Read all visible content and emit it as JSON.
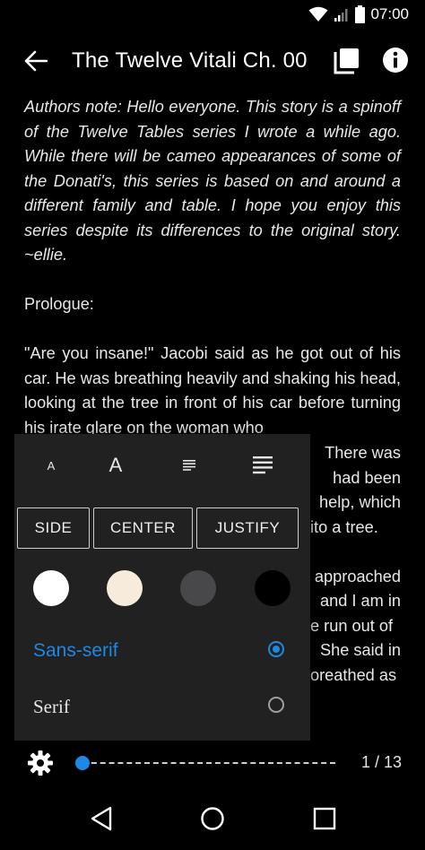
{
  "status_bar": {
    "time": "07:00",
    "icons": [
      "wifi-icon",
      "signal-icon",
      "battery-icon"
    ]
  },
  "app_bar": {
    "title": "The Twelve Vitali Ch. 00",
    "icons": [
      "back-arrow-icon",
      "copy-icon",
      "info-icon"
    ]
  },
  "content": {
    "paragraphs": [
      "Authors note: Hello everyone. This story is a spinoff of the Twelve Tables series I wrote a while ago. While there will be cameo appearances of some of the Donati's, this series is based on and around a different family and table. I hope you enjoy this series despite its differences to the original story. ~ellie.",
      "Prologue:",
      "\"Are you insane!\" Jacobi said as he got out of his car. He was breathing heavily and shaking his head, looking at the tree in front of his car before turning his irate glare on the woman who"
    ],
    "partial_lines": [
      "There was",
      "had been",
      "help, which",
      "ito a tree.",
      "approached",
      "and I am in",
      "e run out of",
      "She said in",
      "oreathed as"
    ]
  },
  "settings_panel": {
    "text_size": {
      "decrease_label": "A",
      "increase_label": "A"
    },
    "alignment": [
      "SIDE",
      "CENTER",
      "JUSTIFY"
    ],
    "themes": [
      {
        "name": "white",
        "color": "#ffffff"
      },
      {
        "name": "sepia",
        "color": "#f7ecdc"
      },
      {
        "name": "gray",
        "color": "#48484a"
      },
      {
        "name": "black",
        "color": "#000000"
      }
    ],
    "fonts": [
      {
        "label": "Sans-serif",
        "selected": true,
        "color": "#1e88e5"
      },
      {
        "label": "Serif",
        "selected": false,
        "color": "#e6e6e6"
      }
    ]
  },
  "bottom_bar": {
    "page_indicator": "1 / 13",
    "progress_fraction": 0
  },
  "nav_bar": {
    "buttons": [
      "back-triangle-icon",
      "home-circle-icon",
      "recents-square-icon"
    ]
  },
  "colors": {
    "accent": "#1e88e5",
    "panel_bg": "#212121",
    "background": "#000000"
  }
}
